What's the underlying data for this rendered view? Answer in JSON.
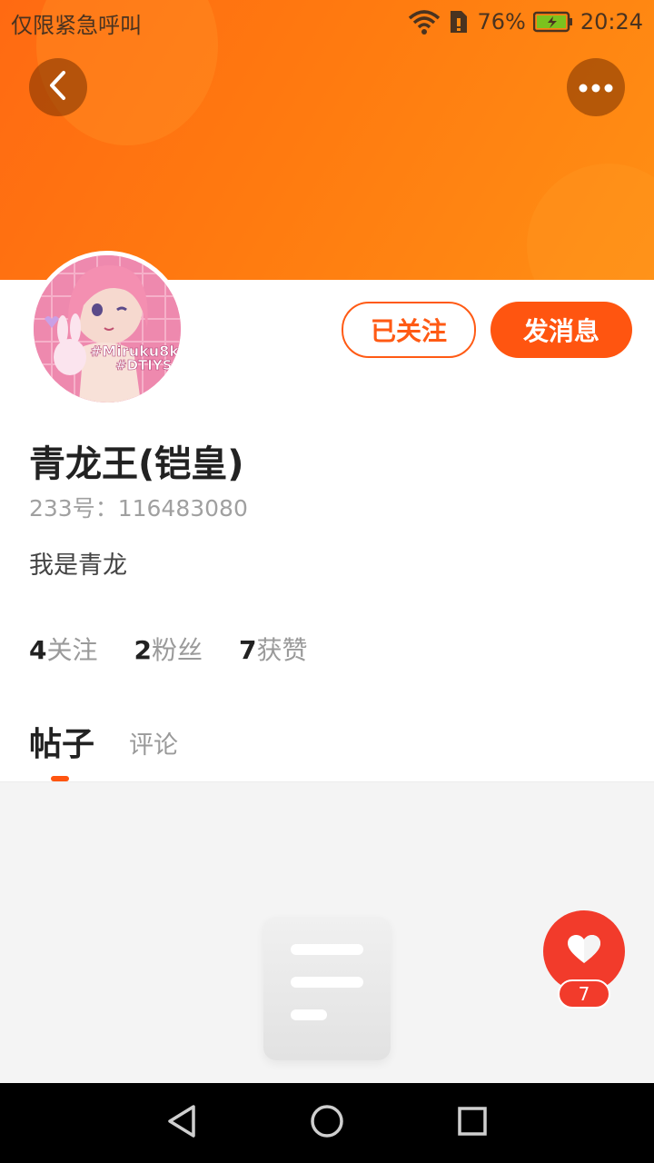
{
  "status_bar": {
    "carrier_text": "仅限紧急呼叫",
    "battery_percent": "76%",
    "time": "20:24",
    "icons": [
      "wifi-icon",
      "sim-icon",
      "battery-charging-icon"
    ]
  },
  "header": {
    "back_icon": "chevron-left-icon",
    "more_icon": "more-horizontal-icon",
    "banner_color": "#ff7a10"
  },
  "profile": {
    "avatar_text_1": "#Miruku8k",
    "avatar_text_2": "#DTIYS",
    "name": "青龙王(铠皇)",
    "uid": "233号：116483080",
    "bio": "我是青龙",
    "follow_label": "已关注",
    "message_label": "发消息"
  },
  "stats": [
    {
      "num": "4",
      "label": "关注"
    },
    {
      "num": "2",
      "label": "粉丝"
    },
    {
      "num": "7",
      "label": "获赞"
    }
  ],
  "tabs": {
    "posts": "帖子",
    "comments": "评论"
  },
  "like_fab": {
    "count": "7",
    "icon": "heart-icon",
    "color": "#f23b2b"
  },
  "accent_color": "#ff5510",
  "navbar": {
    "icons": [
      "back-triangle-icon",
      "home-circle-icon",
      "recents-square-icon"
    ]
  }
}
